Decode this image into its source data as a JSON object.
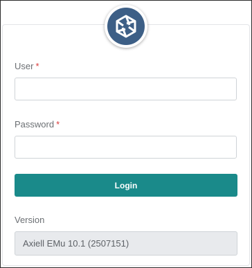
{
  "logo": {
    "icon": "axiell-logo-icon",
    "bg_color": "#3d5f86"
  },
  "form": {
    "user_label": "User",
    "password_label": "Password",
    "required_marker": "*",
    "user_value": "",
    "password_value": "",
    "login_label": "Login",
    "version_label": "Version",
    "version_value": "Axiell EMu 10.1 (2507151)"
  },
  "colors": {
    "accent": "#1a8a8a",
    "required": "#d93a3a"
  }
}
